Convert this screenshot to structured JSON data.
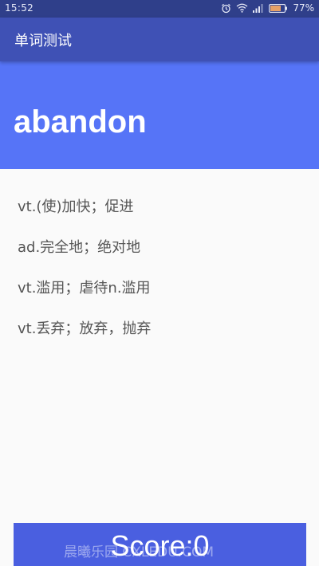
{
  "status_bar": {
    "time": "15:52",
    "battery_percent": "77%",
    "icons": [
      "alarm-icon",
      "wifi-icon",
      "signal-icon",
      "battery-icon"
    ]
  },
  "app_bar": {
    "title": "单词测试"
  },
  "word": {
    "text": "abandon"
  },
  "options": [
    {
      "label": "vt.(使)加快；促进"
    },
    {
      "label": "ad.完全地；绝对地"
    },
    {
      "label": "vt.滥用；虐待n.滥用"
    },
    {
      "label": "vt.丢弃；放弃，抛弃"
    }
  ],
  "score": {
    "label": "Score:0"
  },
  "watermark": {
    "text": "晨曦乐园 CXLEDU.COM"
  },
  "colors": {
    "status_bar": "#2f3f8a",
    "app_bar": "#3f51b5",
    "word_header": "#5674f7",
    "score_button": "#4a5fe0",
    "option_text": "#555555",
    "background": "#fafafa"
  }
}
